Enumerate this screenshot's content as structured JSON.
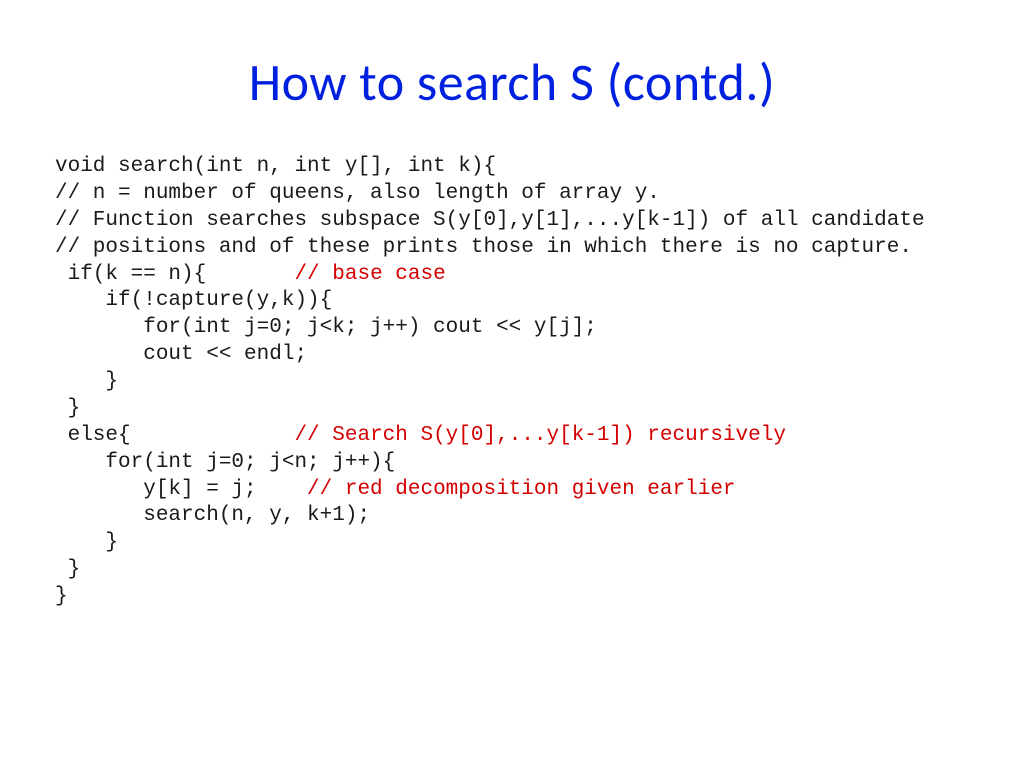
{
  "title": "How to search S (contd.)",
  "code": {
    "l01": "void search(int n, int y[], int k){",
    "l02": "// n = number of queens, also length of array y.",
    "l03": "// Function searches subspace S(y[0],y[1],...y[k-1]) of all candidate",
    "l04": "// positions and of these prints those in which there is no capture.",
    "l05a": " if(k == n){       ",
    "l05b": "// base case",
    "l06": "    if(!capture(y,k)){",
    "l07": "       for(int j=0; j<k; j++) cout << y[j];",
    "l08": "       cout << endl;",
    "l09": "    }",
    "l10": " }",
    "l11a": " else{             ",
    "l11b": "// Search S(y[0],...y[k-1]) recursively",
    "l12": "    for(int j=0; j<n; j++){",
    "l13a": "       y[k] = j;    ",
    "l13b": "// red decomposition given earlier",
    "l14": "       search(n, y, k+1);",
    "l15": "    }",
    "l16": " }",
    "l17": "}"
  }
}
